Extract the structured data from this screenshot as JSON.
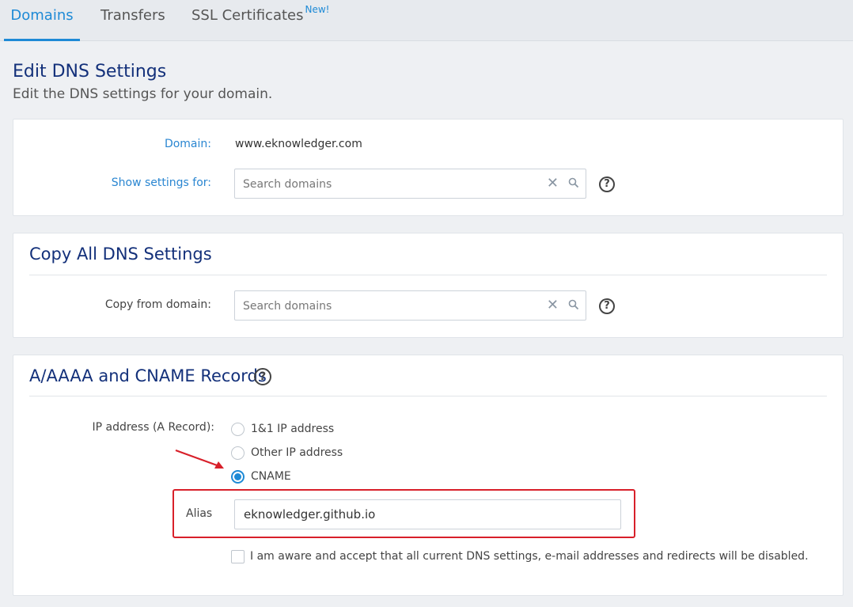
{
  "tabs": [
    {
      "label": "Domains",
      "active": true
    },
    {
      "label": "Transfers",
      "active": false
    },
    {
      "label": "SSL Certificates",
      "badge": "New!",
      "active": false
    }
  ],
  "header": {
    "title": "Edit DNS Settings",
    "subtitle": "Edit the DNS settings for your domain."
  },
  "domain_panel": {
    "domain_label": "Domain:",
    "domain_value": "www.eknowledger.com",
    "show_label": "Show settings for:",
    "search_placeholder": "Search domains"
  },
  "copy_panel": {
    "title": "Copy All DNS Settings",
    "copy_label": "Copy from domain:",
    "search_placeholder": "Search domains"
  },
  "records_panel": {
    "title": "A/AAAA and CNAME Records",
    "ip_label": "IP address (A Record):",
    "options": [
      {
        "label": "1&1 IP address",
        "selected": false
      },
      {
        "label": "Other IP address",
        "selected": false
      },
      {
        "label": "CNAME",
        "selected": true
      }
    ],
    "alias_label": "Alias",
    "alias_value": "eknowledger.github.io",
    "accept_text": "I am aware and accept that all current DNS settings, e-mail addresses and redirects will be disabled.",
    "accept_checked": false
  },
  "colors": {
    "accent": "#1e8ad6",
    "title": "#13307a",
    "highlight": "#d8202a"
  },
  "icons": [
    "clear-icon",
    "search-icon",
    "help-icon",
    "arrow-annotation-icon"
  ]
}
